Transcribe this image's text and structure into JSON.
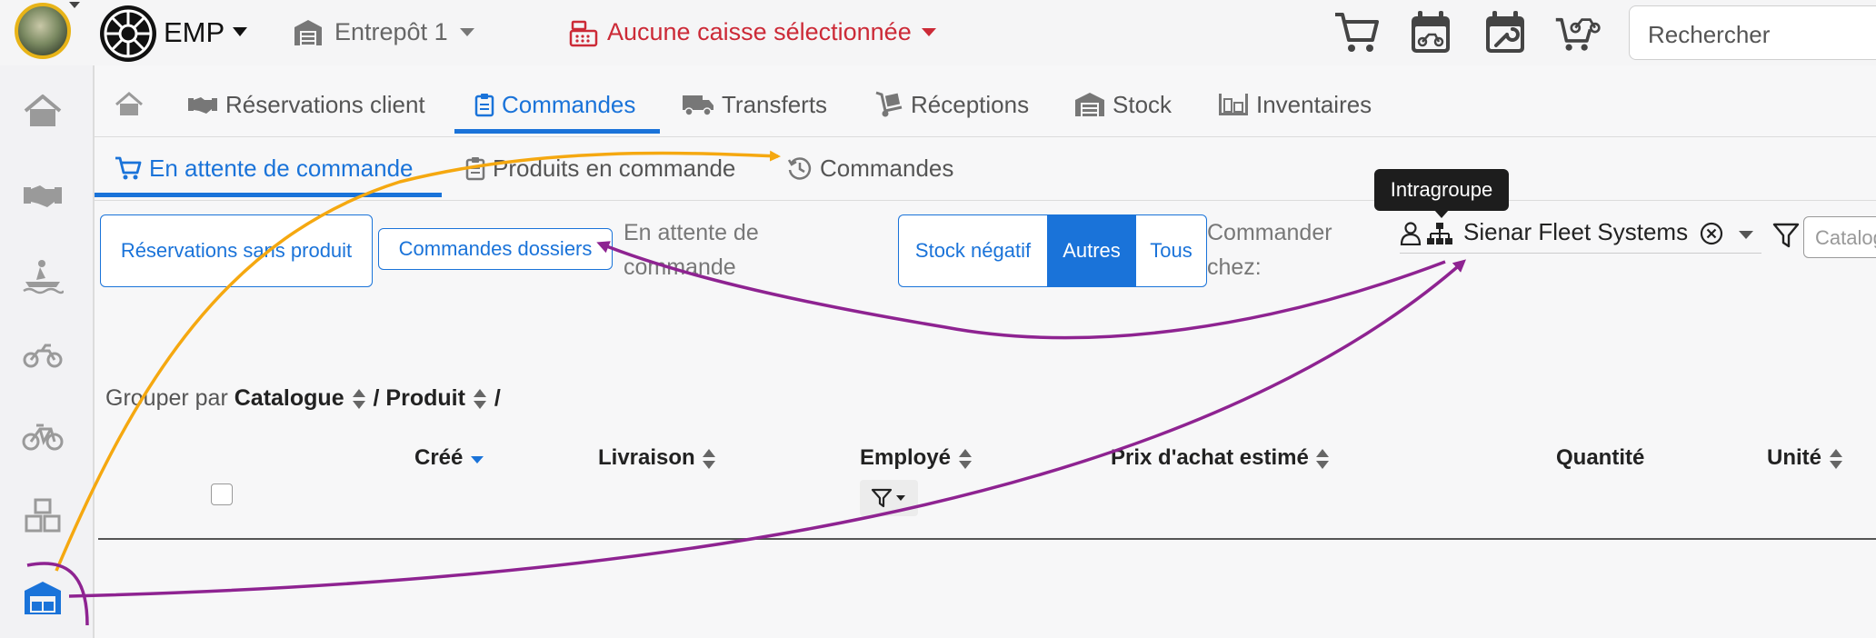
{
  "topbar": {
    "brand": "EMP",
    "warehouse": "Entrepôt 1",
    "register": "Aucune caisse sélectionnée",
    "search_placeholder": "Rechercher"
  },
  "nav_tabs": [
    {
      "label": "",
      "icon": "home-icon"
    },
    {
      "label": "Réservations client",
      "icon": "handshake-icon"
    },
    {
      "label": "Commandes",
      "icon": "clipboard-icon",
      "active": true
    },
    {
      "label": "Transferts",
      "icon": "truck-icon"
    },
    {
      "label": "Réceptions",
      "icon": "dolly-icon"
    },
    {
      "label": "Stock",
      "icon": "warehouse-icon"
    },
    {
      "label": "Inventaires",
      "icon": "pallet-icon"
    }
  ],
  "sub_tabs": [
    {
      "label": "En attente de commande",
      "icon": "cart-icon",
      "active": true
    },
    {
      "label": "Produits en commande",
      "icon": "clipboard-list-icon"
    },
    {
      "label": "Commandes",
      "icon": "history-icon"
    }
  ],
  "toolbar": {
    "reservations_button": "Réservations sans produit",
    "dossiers_button": "Commandes dossiers",
    "status_text": "En attente de commande",
    "segments": [
      "Stock négatif",
      "Autres",
      "Tous"
    ],
    "active_segment": "Autres",
    "order_from_label": "Commander chez:",
    "tooltip": "Intragroupe",
    "supplier": "Sienar Fleet Systems",
    "catalog_placeholder": "Catalogue"
  },
  "grouping": {
    "prefix": "Grouper par",
    "levels": [
      "Catalogue",
      "Produit"
    ],
    "separator": "/"
  },
  "table": {
    "columns": [
      "Créé",
      "Livraison",
      "Employé",
      "Prix d'achat estimé",
      "Quantité",
      "Unité"
    ],
    "sorted_column": "Créé"
  },
  "colors": {
    "accent": "#1a73d9",
    "alert": "#cc2a37",
    "annotation_orange": "#f5a810",
    "annotation_purple": "#8e2391"
  }
}
